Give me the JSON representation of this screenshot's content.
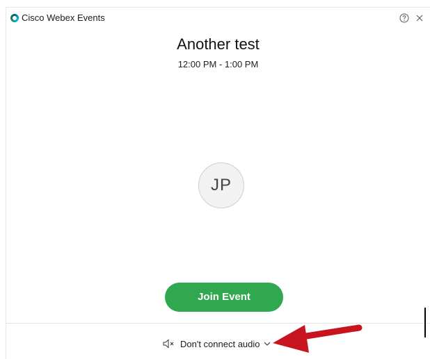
{
  "window": {
    "app_title": "Cisco Webex Events",
    "help_icon": "help-circle-icon",
    "close_icon": "close-icon"
  },
  "event": {
    "title": "Another test",
    "time": "12:00 PM - 1:00 PM"
  },
  "avatar": {
    "initials": "JP"
  },
  "join_button": {
    "label": "Join Event",
    "color": "#2fa84f"
  },
  "audio": {
    "selected": "Don't connect audio",
    "icon": "speaker-muted-icon"
  },
  "annotation": {
    "arrow_color": "#c8141e"
  }
}
